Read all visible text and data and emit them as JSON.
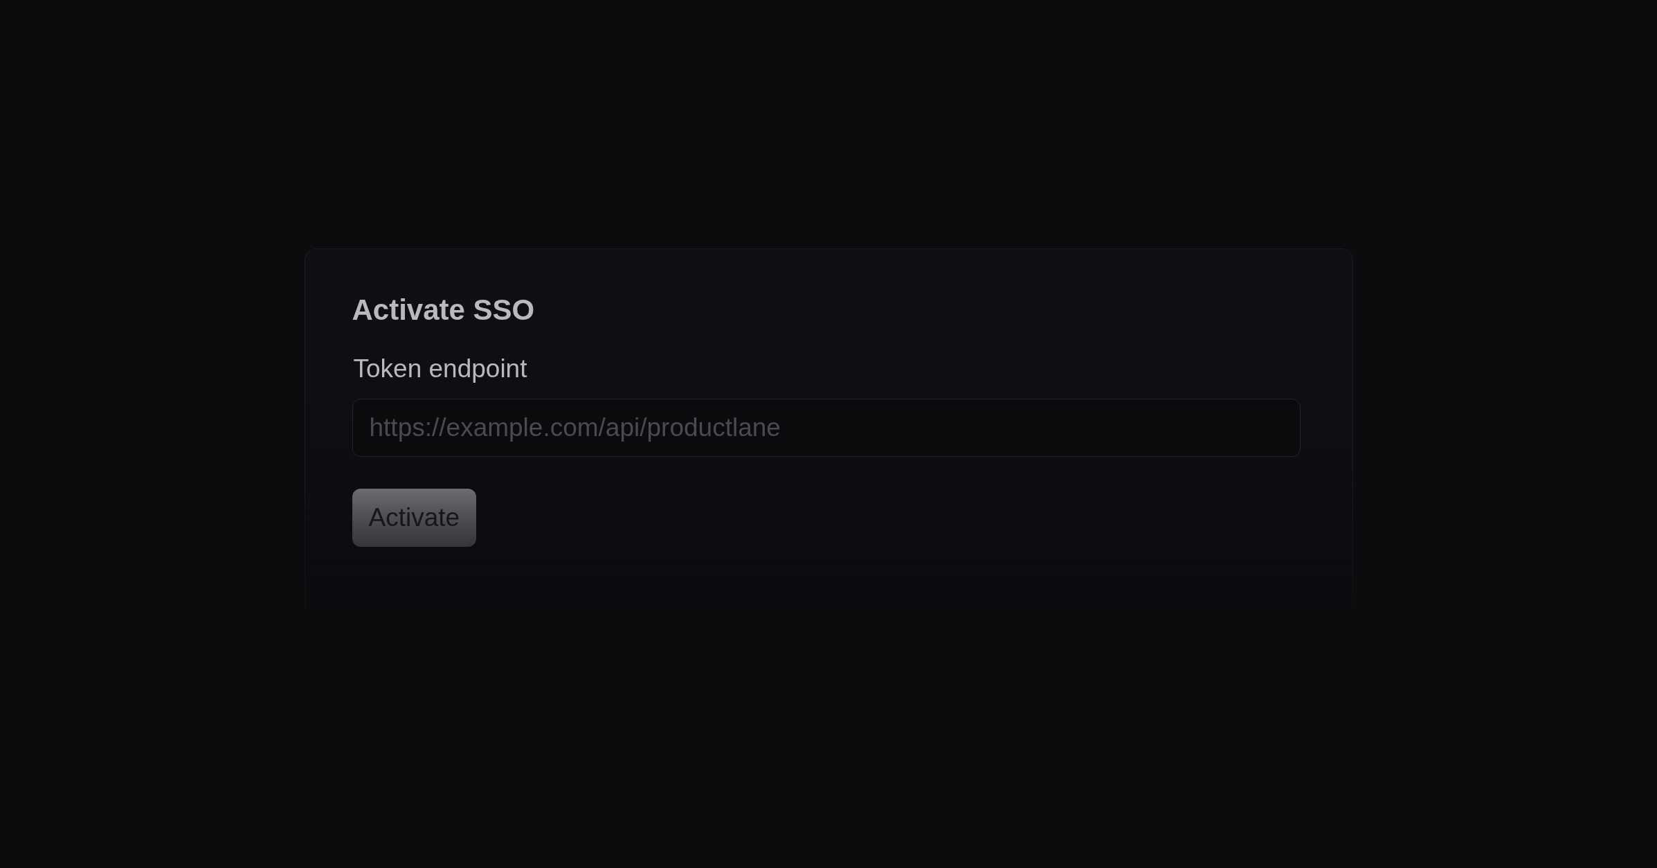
{
  "card": {
    "title": "Activate SSO",
    "field": {
      "label": "Token endpoint",
      "placeholder": "https://example.com/api/productlane"
    },
    "button": {
      "label": "Activate"
    }
  }
}
